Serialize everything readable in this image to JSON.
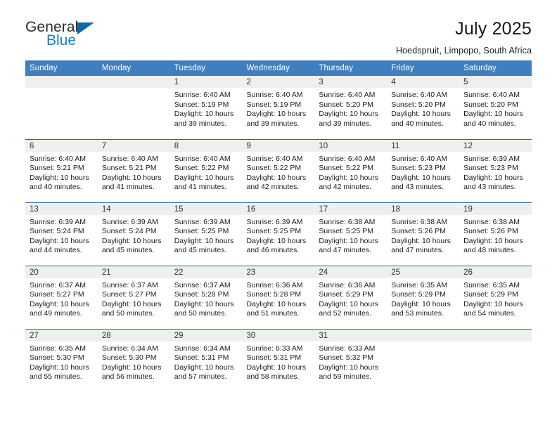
{
  "brand": {
    "logo_general": "General",
    "logo_blue": "Blue",
    "logo_icon": "triangle-icon"
  },
  "header": {
    "title": "July 2025",
    "subtitle": "Hoedspruit, Limpopo, South Africa"
  },
  "colors": {
    "header_blue": "#3f7fbf",
    "row_separator": "#1b69ab",
    "daynum_band": "#efefef",
    "logo_blue": "#1a7fc1",
    "logo_triangle": "#1068a8"
  },
  "weekday_headers": [
    "Sunday",
    "Monday",
    "Tuesday",
    "Wednesday",
    "Thursday",
    "Friday",
    "Saturday"
  ],
  "labels": {
    "sunrise_prefix": "Sunrise:",
    "sunset_prefix": "Sunset:",
    "daylight_prefix": "Daylight:"
  },
  "weeks": [
    [
      {
        "day": "",
        "blank": true,
        "line1": "",
        "line2": "",
        "line3": "",
        "line4": ""
      },
      {
        "day": "",
        "blank": true,
        "line1": "",
        "line2": "",
        "line3": "",
        "line4": ""
      },
      {
        "day": "1",
        "line1": "Sunrise: 6:40 AM",
        "line2": "Sunset: 5:19 PM",
        "line3": "Daylight: 10 hours",
        "line4": "and 39 minutes."
      },
      {
        "day": "2",
        "line1": "Sunrise: 6:40 AM",
        "line2": "Sunset: 5:19 PM",
        "line3": "Daylight: 10 hours",
        "line4": "and 39 minutes."
      },
      {
        "day": "3",
        "line1": "Sunrise: 6:40 AM",
        "line2": "Sunset: 5:20 PM",
        "line3": "Daylight: 10 hours",
        "line4": "and 39 minutes."
      },
      {
        "day": "4",
        "line1": "Sunrise: 6:40 AM",
        "line2": "Sunset: 5:20 PM",
        "line3": "Daylight: 10 hours",
        "line4": "and 40 minutes."
      },
      {
        "day": "5",
        "line1": "Sunrise: 6:40 AM",
        "line2": "Sunset: 5:20 PM",
        "line3": "Daylight: 10 hours",
        "line4": "and 40 minutes."
      }
    ],
    [
      {
        "day": "6",
        "line1": "Sunrise: 6:40 AM",
        "line2": "Sunset: 5:21 PM",
        "line3": "Daylight: 10 hours",
        "line4": "and 40 minutes."
      },
      {
        "day": "7",
        "line1": "Sunrise: 6:40 AM",
        "line2": "Sunset: 5:21 PM",
        "line3": "Daylight: 10 hours",
        "line4": "and 41 minutes."
      },
      {
        "day": "8",
        "line1": "Sunrise: 6:40 AM",
        "line2": "Sunset: 5:22 PM",
        "line3": "Daylight: 10 hours",
        "line4": "and 41 minutes."
      },
      {
        "day": "9",
        "line1": "Sunrise: 6:40 AM",
        "line2": "Sunset: 5:22 PM",
        "line3": "Daylight: 10 hours",
        "line4": "and 42 minutes."
      },
      {
        "day": "10",
        "line1": "Sunrise: 6:40 AM",
        "line2": "Sunset: 5:22 PM",
        "line3": "Daylight: 10 hours",
        "line4": "and 42 minutes."
      },
      {
        "day": "11",
        "line1": "Sunrise: 6:40 AM",
        "line2": "Sunset: 5:23 PM",
        "line3": "Daylight: 10 hours",
        "line4": "and 43 minutes."
      },
      {
        "day": "12",
        "line1": "Sunrise: 6:39 AM",
        "line2": "Sunset: 5:23 PM",
        "line3": "Daylight: 10 hours",
        "line4": "and 43 minutes."
      }
    ],
    [
      {
        "day": "13",
        "line1": "Sunrise: 6:39 AM",
        "line2": "Sunset: 5:24 PM",
        "line3": "Daylight: 10 hours",
        "line4": "and 44 minutes."
      },
      {
        "day": "14",
        "line1": "Sunrise: 6:39 AM",
        "line2": "Sunset: 5:24 PM",
        "line3": "Daylight: 10 hours",
        "line4": "and 45 minutes."
      },
      {
        "day": "15",
        "line1": "Sunrise: 6:39 AM",
        "line2": "Sunset: 5:25 PM",
        "line3": "Daylight: 10 hours",
        "line4": "and 45 minutes."
      },
      {
        "day": "16",
        "line1": "Sunrise: 6:39 AM",
        "line2": "Sunset: 5:25 PM",
        "line3": "Daylight: 10 hours",
        "line4": "and 46 minutes."
      },
      {
        "day": "17",
        "line1": "Sunrise: 6:38 AM",
        "line2": "Sunset: 5:25 PM",
        "line3": "Daylight: 10 hours",
        "line4": "and 47 minutes."
      },
      {
        "day": "18",
        "line1": "Sunrise: 6:38 AM",
        "line2": "Sunset: 5:26 PM",
        "line3": "Daylight: 10 hours",
        "line4": "and 47 minutes."
      },
      {
        "day": "19",
        "line1": "Sunrise: 6:38 AM",
        "line2": "Sunset: 5:26 PM",
        "line3": "Daylight: 10 hours",
        "line4": "and 48 minutes."
      }
    ],
    [
      {
        "day": "20",
        "line1": "Sunrise: 6:37 AM",
        "line2": "Sunset: 5:27 PM",
        "line3": "Daylight: 10 hours",
        "line4": "and 49 minutes."
      },
      {
        "day": "21",
        "line1": "Sunrise: 6:37 AM",
        "line2": "Sunset: 5:27 PM",
        "line3": "Daylight: 10 hours",
        "line4": "and 50 minutes."
      },
      {
        "day": "22",
        "line1": "Sunrise: 6:37 AM",
        "line2": "Sunset: 5:28 PM",
        "line3": "Daylight: 10 hours",
        "line4": "and 50 minutes."
      },
      {
        "day": "23",
        "line1": "Sunrise: 6:36 AM",
        "line2": "Sunset: 5:28 PM",
        "line3": "Daylight: 10 hours",
        "line4": "and 51 minutes."
      },
      {
        "day": "24",
        "line1": "Sunrise: 6:36 AM",
        "line2": "Sunset: 5:29 PM",
        "line3": "Daylight: 10 hours",
        "line4": "and 52 minutes."
      },
      {
        "day": "25",
        "line1": "Sunrise: 6:35 AM",
        "line2": "Sunset: 5:29 PM",
        "line3": "Daylight: 10 hours",
        "line4": "and 53 minutes."
      },
      {
        "day": "26",
        "line1": "Sunrise: 6:35 AM",
        "line2": "Sunset: 5:29 PM",
        "line3": "Daylight: 10 hours",
        "line4": "and 54 minutes."
      }
    ],
    [
      {
        "day": "27",
        "line1": "Sunrise: 6:35 AM",
        "line2": "Sunset: 5:30 PM",
        "line3": "Daylight: 10 hours",
        "line4": "and 55 minutes."
      },
      {
        "day": "28",
        "line1": "Sunrise: 6:34 AM",
        "line2": "Sunset: 5:30 PM",
        "line3": "Daylight: 10 hours",
        "line4": "and 56 minutes."
      },
      {
        "day": "29",
        "line1": "Sunrise: 6:34 AM",
        "line2": "Sunset: 5:31 PM",
        "line3": "Daylight: 10 hours",
        "line4": "and 57 minutes."
      },
      {
        "day": "30",
        "line1": "Sunrise: 6:33 AM",
        "line2": "Sunset: 5:31 PM",
        "line3": "Daylight: 10 hours",
        "line4": "and 58 minutes."
      },
      {
        "day": "31",
        "line1": "Sunrise: 6:33 AM",
        "line2": "Sunset: 5:32 PM",
        "line3": "Daylight: 10 hours",
        "line4": "and 59 minutes."
      },
      {
        "day": "",
        "blank": true,
        "line1": "",
        "line2": "",
        "line3": "",
        "line4": ""
      },
      {
        "day": "",
        "blank": true,
        "line1": "",
        "line2": "",
        "line3": "",
        "line4": ""
      }
    ]
  ]
}
